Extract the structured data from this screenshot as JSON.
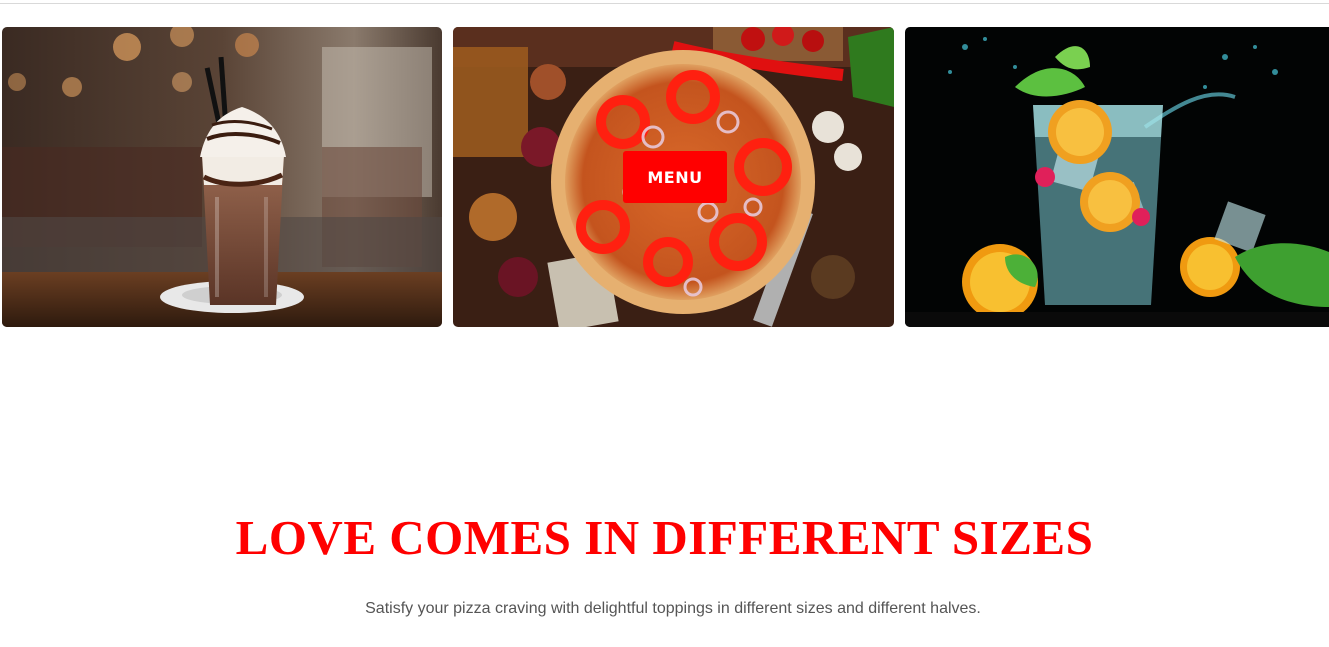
{
  "gallery": {
    "tiles": [
      {
        "image": "chocolate-milkshake-photo"
      },
      {
        "image": "pepperoni-pepper-pizza-photo",
        "button_label": "MENU"
      },
      {
        "image": "citrus-mojito-splash-photo"
      }
    ]
  },
  "hero": {
    "headline": "LOVE COMES IN DIFFERENT SIZES",
    "subtitle": "Satisfy your pizza craving with delightful toppings in different sizes and different halves."
  },
  "colors": {
    "accent": "#ff0000",
    "subtitle_text": "#555555",
    "background": "#ffffff"
  }
}
